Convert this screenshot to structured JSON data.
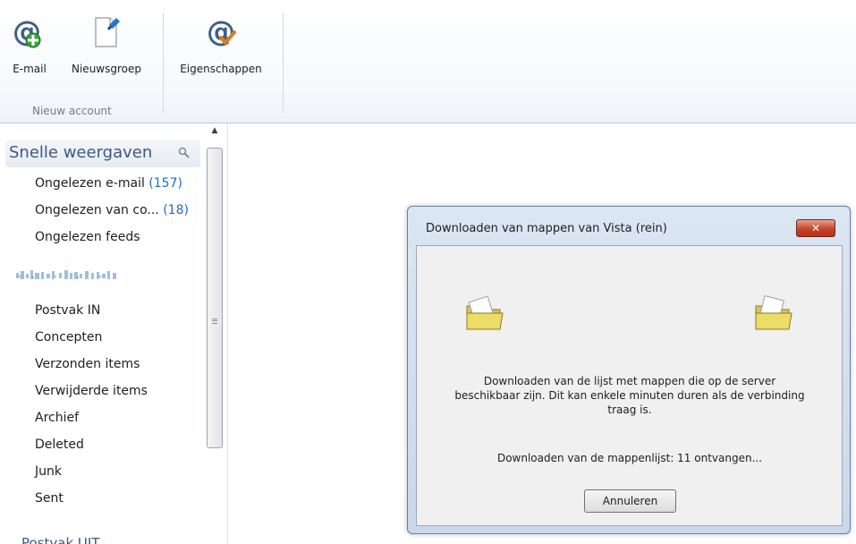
{
  "ribbon": {
    "email_label": "E-mail",
    "newsgroup_label": "Nieuwsgroep",
    "properties_label": "Eigenschappen",
    "group_label": "Nieuw account"
  },
  "nav": {
    "quick_views": "Snelle weergaven",
    "unread_email": "Ongelezen e-mail",
    "unread_email_count": "(157)",
    "unread_from": "Ongelezen van co...",
    "unread_from_count": "(18)",
    "unread_feeds": "Ongelezen feeds",
    "folders": [
      "Postvak IN",
      "Concepten",
      "Verzonden items",
      "Verwijderde items",
      "Archief",
      "Deleted",
      "Junk",
      "Sent"
    ],
    "outbox": "Postvak UIT"
  },
  "dialog": {
    "title": "Downloaden van mappen van Vista (rein)",
    "message": "Downloaden van de lijst met mappen die op de server beschikbaar zijn. Dit kan enkele minuten duren als de verbinding traag is.",
    "status": "Downloaden van de mappenlijst: 11 ontvangen...",
    "cancel_label": "Annuleren"
  },
  "colors": {
    "count_blue": "#1f6cc7",
    "nav_header_text": "#3d5a80",
    "close_red": "#c7442c"
  }
}
